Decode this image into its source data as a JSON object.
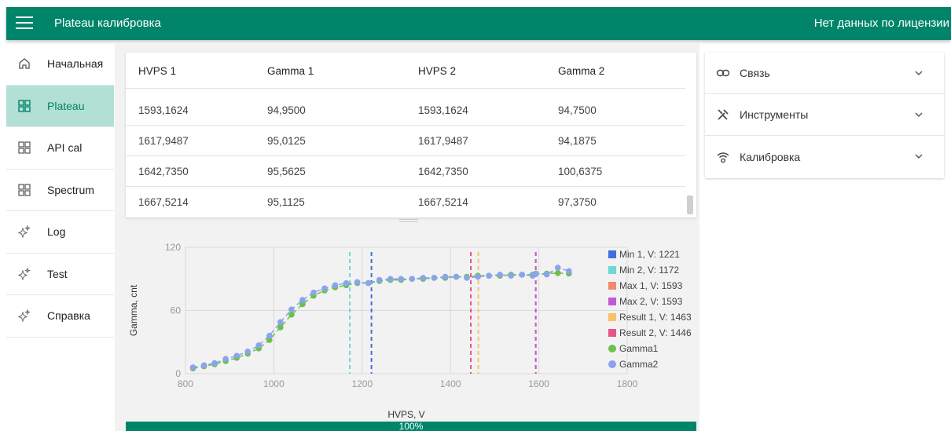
{
  "appbar": {
    "title": "Plateau калибровка",
    "license": "Нет данных по лицензии"
  },
  "sidebar": {
    "items": [
      {
        "label": "Начальная",
        "icon": "home-icon"
      },
      {
        "label": "Plateau",
        "icon": "grid-icon",
        "active": true
      },
      {
        "label": "API cal",
        "icon": "grid-icon"
      },
      {
        "label": "Spectrum",
        "icon": "grid-icon"
      },
      {
        "label": "Log",
        "icon": "sparkle-icon"
      },
      {
        "label": "Test",
        "icon": "sparkle-icon"
      },
      {
        "label": "Справка",
        "icon": "sparkle-icon"
      }
    ]
  },
  "table": {
    "headers": [
      "HVPS 1",
      "Gamma 1",
      "HVPS 2",
      "Gamma 2"
    ],
    "rows": [
      [
        "1593,1624",
        "94,9500",
        "1593,1624",
        "94,7500"
      ],
      [
        "1617,9487",
        "95,0125",
        "1617,9487",
        "94,1875"
      ],
      [
        "1642,7350",
        "95,5625",
        "1642,7350",
        "100,6375"
      ],
      [
        "1667,5214",
        "95,1125",
        "1667,5214",
        "97,3750"
      ]
    ]
  },
  "right_panel": {
    "sections": [
      {
        "label": "Связь",
        "icon": "link-icon"
      },
      {
        "label": "Инструменты",
        "icon": "tools-icon"
      },
      {
        "label": "Калибровка",
        "icon": "wifi-icon"
      }
    ]
  },
  "progress": {
    "value": 100,
    "label": "100%"
  },
  "chart_data": {
    "type": "scatter",
    "xlabel": "HVPS, V",
    "ylabel": "Gamma, cnt",
    "xlim": [
      800,
      1800
    ],
    "ylim": [
      0,
      120
    ],
    "xticks": [
      800,
      1000,
      1200,
      1400,
      1600,
      1800
    ],
    "yticks": [
      0,
      60,
      120
    ],
    "grid": true,
    "legend": "right",
    "vlines": [
      {
        "name": "Min 1, V: 1221",
        "x": 1221,
        "color": "#3d6fe0"
      },
      {
        "name": "Min 2, V: 1172",
        "x": 1172,
        "color": "#6ed8d2"
      },
      {
        "name": "Max 1, V: 1593",
        "x": 1593,
        "color": "#f08a70"
      },
      {
        "name": "Max 2, V: 1593",
        "x": 1593,
        "color": "#c25ad6"
      },
      {
        "name": "Result 1, V: 1463",
        "x": 1463,
        "color": "#f5c36a"
      },
      {
        "name": "Result 2, V: 1446",
        "x": 1446,
        "color": "#e8528a"
      }
    ],
    "series": [
      {
        "name": "Gamma1",
        "color": "#6cc04a",
        "x": [
          817,
          842,
          866,
          891,
          916,
          941,
          966,
          990,
          1015,
          1040,
          1065,
          1090,
          1115,
          1139,
          1164,
          1189,
          1214,
          1239,
          1264,
          1288,
          1313,
          1338,
          1363,
          1388,
          1413,
          1437,
          1462,
          1487,
          1512,
          1537,
          1562,
          1586,
          1593,
          1618,
          1643,
          1668
        ],
        "values": [
          5,
          7,
          9,
          12,
          15,
          19,
          24,
          32,
          44,
          56,
          66,
          74,
          79,
          82,
          84,
          86,
          86,
          88,
          89,
          89,
          90,
          90,
          91,
          91,
          92,
          92,
          93,
          93,
          93,
          94,
          94,
          94,
          94.95,
          95.01,
          95.56,
          95.11
        ]
      },
      {
        "name": "Gamma2",
        "color": "#8aa4ec",
        "x": [
          817,
          842,
          866,
          891,
          916,
          941,
          966,
          990,
          1015,
          1040,
          1065,
          1090,
          1115,
          1139,
          1164,
          1189,
          1214,
          1239,
          1264,
          1288,
          1313,
          1338,
          1363,
          1388,
          1413,
          1437,
          1462,
          1487,
          1512,
          1537,
          1562,
          1586,
          1593,
          1618,
          1643,
          1668
        ],
        "values": [
          6,
          8,
          10,
          14,
          17,
          21,
          27,
          36,
          49,
          61,
          70,
          77,
          81,
          84,
          86,
          87,
          86,
          89,
          90,
          90,
          90,
          91,
          91,
          92,
          92,
          91,
          92,
          93,
          94,
          93,
          94,
          93,
          94.75,
          94.19,
          100.64,
          97.38
        ]
      }
    ]
  }
}
